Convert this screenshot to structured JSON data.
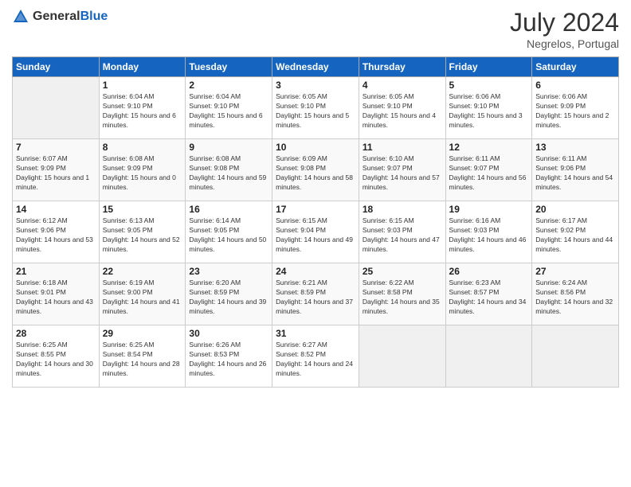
{
  "header": {
    "logo_general": "General",
    "logo_blue": "Blue",
    "month_year": "July 2024",
    "location": "Negrelos, Portugal"
  },
  "days_of_week": [
    "Sunday",
    "Monday",
    "Tuesday",
    "Wednesday",
    "Thursday",
    "Friday",
    "Saturday"
  ],
  "weeks": [
    [
      {
        "day": "",
        "empty": true
      },
      {
        "day": "1",
        "sunrise": "6:04 AM",
        "sunset": "9:10 PM",
        "daylight": "15 hours and 6 minutes."
      },
      {
        "day": "2",
        "sunrise": "6:04 AM",
        "sunset": "9:10 PM",
        "daylight": "15 hours and 6 minutes."
      },
      {
        "day": "3",
        "sunrise": "6:05 AM",
        "sunset": "9:10 PM",
        "daylight": "15 hours and 5 minutes."
      },
      {
        "day": "4",
        "sunrise": "6:05 AM",
        "sunset": "9:10 PM",
        "daylight": "15 hours and 4 minutes."
      },
      {
        "day": "5",
        "sunrise": "6:06 AM",
        "sunset": "9:10 PM",
        "daylight": "15 hours and 3 minutes."
      },
      {
        "day": "6",
        "sunrise": "6:06 AM",
        "sunset": "9:09 PM",
        "daylight": "15 hours and 2 minutes."
      }
    ],
    [
      {
        "day": "7",
        "sunrise": "6:07 AM",
        "sunset": "9:09 PM",
        "daylight": "15 hours and 1 minute."
      },
      {
        "day": "8",
        "sunrise": "6:08 AM",
        "sunset": "9:09 PM",
        "daylight": "15 hours and 0 minutes."
      },
      {
        "day": "9",
        "sunrise": "6:08 AM",
        "sunset": "9:08 PM",
        "daylight": "14 hours and 59 minutes."
      },
      {
        "day": "10",
        "sunrise": "6:09 AM",
        "sunset": "9:08 PM",
        "daylight": "14 hours and 58 minutes."
      },
      {
        "day": "11",
        "sunrise": "6:10 AM",
        "sunset": "9:07 PM",
        "daylight": "14 hours and 57 minutes."
      },
      {
        "day": "12",
        "sunrise": "6:11 AM",
        "sunset": "9:07 PM",
        "daylight": "14 hours and 56 minutes."
      },
      {
        "day": "13",
        "sunrise": "6:11 AM",
        "sunset": "9:06 PM",
        "daylight": "14 hours and 54 minutes."
      }
    ],
    [
      {
        "day": "14",
        "sunrise": "6:12 AM",
        "sunset": "9:06 PM",
        "daylight": "14 hours and 53 minutes."
      },
      {
        "day": "15",
        "sunrise": "6:13 AM",
        "sunset": "9:05 PM",
        "daylight": "14 hours and 52 minutes."
      },
      {
        "day": "16",
        "sunrise": "6:14 AM",
        "sunset": "9:05 PM",
        "daylight": "14 hours and 50 minutes."
      },
      {
        "day": "17",
        "sunrise": "6:15 AM",
        "sunset": "9:04 PM",
        "daylight": "14 hours and 49 minutes."
      },
      {
        "day": "18",
        "sunrise": "6:15 AM",
        "sunset": "9:03 PM",
        "daylight": "14 hours and 47 minutes."
      },
      {
        "day": "19",
        "sunrise": "6:16 AM",
        "sunset": "9:03 PM",
        "daylight": "14 hours and 46 minutes."
      },
      {
        "day": "20",
        "sunrise": "6:17 AM",
        "sunset": "9:02 PM",
        "daylight": "14 hours and 44 minutes."
      }
    ],
    [
      {
        "day": "21",
        "sunrise": "6:18 AM",
        "sunset": "9:01 PM",
        "daylight": "14 hours and 43 minutes."
      },
      {
        "day": "22",
        "sunrise": "6:19 AM",
        "sunset": "9:00 PM",
        "daylight": "14 hours and 41 minutes."
      },
      {
        "day": "23",
        "sunrise": "6:20 AM",
        "sunset": "8:59 PM",
        "daylight": "14 hours and 39 minutes."
      },
      {
        "day": "24",
        "sunrise": "6:21 AM",
        "sunset": "8:59 PM",
        "daylight": "14 hours and 37 minutes."
      },
      {
        "day": "25",
        "sunrise": "6:22 AM",
        "sunset": "8:58 PM",
        "daylight": "14 hours and 35 minutes."
      },
      {
        "day": "26",
        "sunrise": "6:23 AM",
        "sunset": "8:57 PM",
        "daylight": "14 hours and 34 minutes."
      },
      {
        "day": "27",
        "sunrise": "6:24 AM",
        "sunset": "8:56 PM",
        "daylight": "14 hours and 32 minutes."
      }
    ],
    [
      {
        "day": "28",
        "sunrise": "6:25 AM",
        "sunset": "8:55 PM",
        "daylight": "14 hours and 30 minutes."
      },
      {
        "day": "29",
        "sunrise": "6:25 AM",
        "sunset": "8:54 PM",
        "daylight": "14 hours and 28 minutes."
      },
      {
        "day": "30",
        "sunrise": "6:26 AM",
        "sunset": "8:53 PM",
        "daylight": "14 hours and 26 minutes."
      },
      {
        "day": "31",
        "sunrise": "6:27 AM",
        "sunset": "8:52 PM",
        "daylight": "14 hours and 24 minutes."
      },
      {
        "day": "",
        "empty": true
      },
      {
        "day": "",
        "empty": true
      },
      {
        "day": "",
        "empty": true
      }
    ]
  ]
}
